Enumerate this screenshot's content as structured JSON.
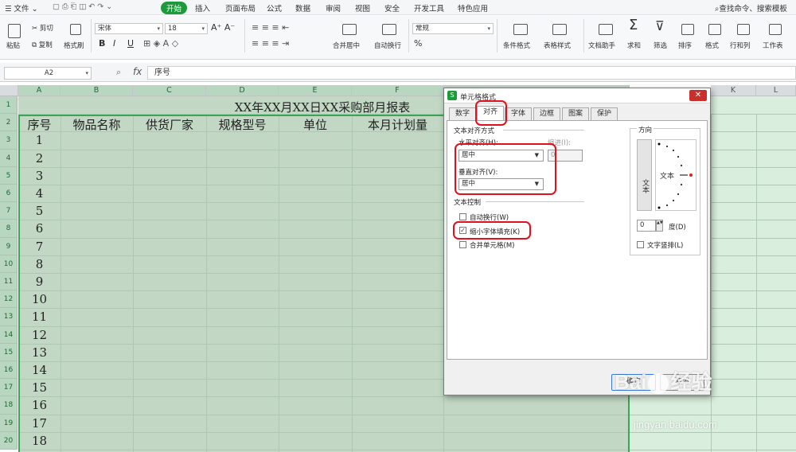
{
  "menu": {
    "file": "文件",
    "items": [
      "开始",
      "插入",
      "页面布局",
      "公式",
      "数据",
      "审阅",
      "视图",
      "安全",
      "开发工具",
      "特色应用"
    ],
    "search": "查找命令、搜索模板"
  },
  "ribbon": {
    "paste": "粘贴",
    "cut": "剪切",
    "copy": "复制",
    "format_painter": "格式刷",
    "font_name": "宋体",
    "font_size": "18",
    "bold": "B",
    "italic": "I",
    "underline": "U",
    "merge_center": "合并居中",
    "auto_wrap": "自动换行",
    "number_format": "常规",
    "percent": "%",
    "cond_format": "条件格式",
    "table_style": "表格样式",
    "doc_helper": "文档助手",
    "sum": "求和",
    "filter": "筛选",
    "sort": "排序",
    "format": "格式",
    "row_col": "行和列",
    "worksheet": "工作表"
  },
  "formula": {
    "name_box": "A2",
    "fx": "fx",
    "content": "序号"
  },
  "columns": [
    "A",
    "B",
    "C",
    "D",
    "E",
    "F",
    "K",
    "L"
  ],
  "rows": [
    "1",
    "2",
    "3",
    "4",
    "5",
    "6",
    "7",
    "8",
    "9",
    "10",
    "11",
    "12",
    "13",
    "14",
    "15",
    "16",
    "17",
    "18",
    "19",
    "20"
  ],
  "sheet": {
    "title": "XX年XX月XX日XX采购部月报表",
    "headers": [
      "序号",
      "物品名称",
      "供货厂家",
      "规格型号",
      "单位",
      "本月计划量"
    ],
    "serials": [
      "1",
      "2",
      "3",
      "4",
      "5",
      "6",
      "7",
      "8",
      "9",
      "10",
      "11",
      "12",
      "13",
      "14",
      "15",
      "16",
      "17",
      "18"
    ]
  },
  "dialog": {
    "title": "单元格格式",
    "tabs": [
      "数字",
      "对齐",
      "字体",
      "边框",
      "图案",
      "保护"
    ],
    "text_align_section": "文本对齐方式",
    "horizontal_label": "水平对齐(H):",
    "horizontal_value": "居中",
    "indent_label": "缩进(I):",
    "indent_value": "0",
    "vertical_label": "垂直对齐(V):",
    "vertical_value": "居中",
    "text_control_section": "文本控制",
    "wrap_text": "自动换行(W)",
    "shrink_to_fit": "缩小字体填充(K)",
    "shrink_checked": "✓",
    "merge_cells": "合并单元格(M)",
    "orientation_section": "方向",
    "vertical_text": "文本",
    "orientation_text": "文本",
    "degrees_value": "0",
    "degrees_label": "度(D)",
    "stacked_text": "文字竖排(L)",
    "ok": "确定",
    "cancel": "取消"
  },
  "watermark": {
    "logo": "Bai",
    "logo2": "经验",
    "url": "jingyan.baidu.com"
  },
  "colors": {
    "accent": "#1d9b3c",
    "highlight": "#e0111d",
    "selection": "#c2d8c4"
  }
}
